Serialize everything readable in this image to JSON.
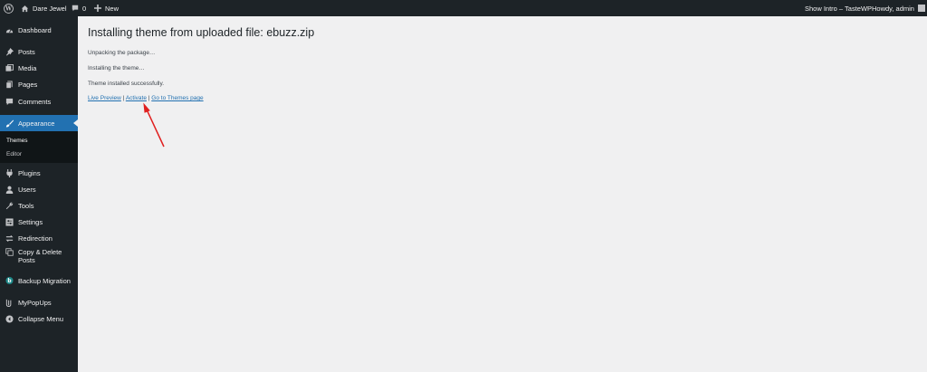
{
  "adminbar": {
    "site_name": "Dare Jewel",
    "comments_count": "0",
    "new_label": "New",
    "show_intro": "Show Intro – TasteWP",
    "howdy": "Howdy, admin"
  },
  "sidebar": {
    "items": [
      {
        "label": "Dashboard",
        "icon": "dashboard-icon"
      },
      {
        "label": "Posts",
        "icon": "pin-icon"
      },
      {
        "label": "Media",
        "icon": "media-icon"
      },
      {
        "label": "Pages",
        "icon": "pages-icon"
      },
      {
        "label": "Comments",
        "icon": "comment-icon"
      },
      {
        "label": "Appearance",
        "icon": "brush-icon"
      },
      {
        "label": "Plugins",
        "icon": "plugin-icon"
      },
      {
        "label": "Users",
        "icon": "user-icon"
      },
      {
        "label": "Tools",
        "icon": "wrench-icon"
      },
      {
        "label": "Settings",
        "icon": "settings-icon"
      },
      {
        "label": "Redirection",
        "icon": "redirect-icon"
      },
      {
        "label": "Copy & Delete Posts",
        "icon": "copy-icon"
      },
      {
        "label": "Backup Migration",
        "icon": "backup-icon"
      },
      {
        "label": "MyPopUps",
        "icon": "popup-icon"
      },
      {
        "label": "Collapse Menu",
        "icon": "collapse-icon"
      }
    ],
    "submenu": [
      "Themes",
      "Editor"
    ],
    "active": "Appearance"
  },
  "content": {
    "title": "Installing theme from uploaded file: ebuzz.zip",
    "messages": [
      "Unpacking the package…",
      "Installing the theme…",
      "Theme installed successfully."
    ],
    "links": {
      "live_preview": "Live Preview",
      "activate": "Activate",
      "themes_page": "Go to Themes page",
      "separator": "|"
    }
  },
  "colors": {
    "adminbar_bg": "#1d2327",
    "sidebar_bg": "#1d2327",
    "active_bg": "#2271b1",
    "link": "#2271b1",
    "content_bg": "#f0f0f1",
    "annotation_arrow": "#e02020"
  }
}
